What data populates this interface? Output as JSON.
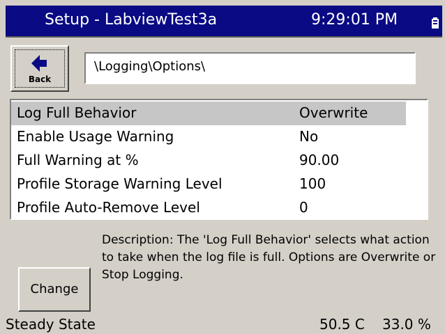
{
  "titlebar": {
    "title": "Setup - LabviewTest3a",
    "clock": "9:29:01 PM"
  },
  "back_button": {
    "label": "Back"
  },
  "path": {
    "value": "\\Logging\\Options\\"
  },
  "settings": [
    {
      "name": "Log Full Behavior",
      "value": "Overwrite",
      "selected": true
    },
    {
      "name": "Enable Usage Warning",
      "value": "No",
      "selected": false
    },
    {
      "name": "Full Warning at %",
      "value": "90.00",
      "selected": false
    },
    {
      "name": "Profile Storage Warning Level",
      "value": "100",
      "selected": false
    },
    {
      "name": "Profile Auto-Remove Level",
      "value": "0",
      "selected": false
    }
  ],
  "description": {
    "text": "Description:  The 'Log Full Behavior' selects what action to take when the log file is full.  Options are Overwrite or Stop Logging."
  },
  "change_button": {
    "label": "Change"
  },
  "status": {
    "state": "Steady State",
    "temperature": "50.5 C",
    "humidity": "33.0 %"
  },
  "colors": {
    "titlebar": "#0a0a84",
    "background": "#d4d0c8",
    "selected_row": "#c6c6c6"
  },
  "icons": {
    "back": "left-arrow-icon",
    "battery": "battery-icon"
  }
}
